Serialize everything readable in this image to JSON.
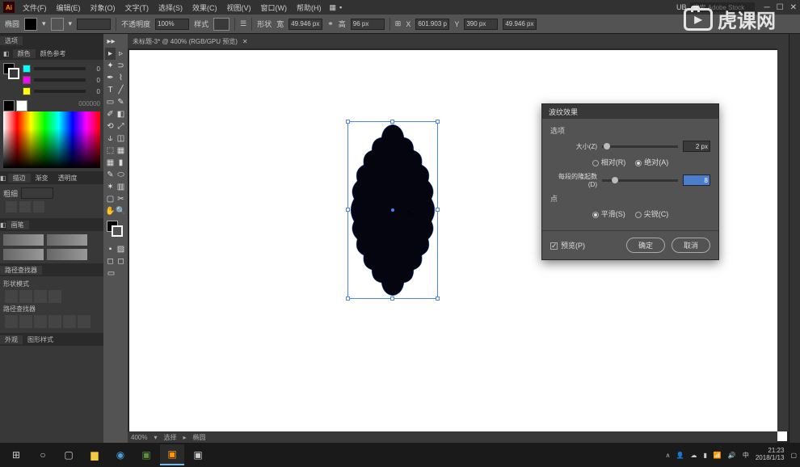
{
  "app_icon": "Ai",
  "menubar": {
    "items": [
      "文件(F)",
      "编辑(E)",
      "对象(O)",
      "文字(T)",
      "选择(S)",
      "效果(C)",
      "视图(V)",
      "窗口(W)",
      "帮助(H)"
    ],
    "search_placeholder": "搜索 Adobe Stock",
    "layout_label": "UB"
  },
  "options": {
    "label_left": "椭圆",
    "opacity_label": "不透明度",
    "opacity_value": "100%",
    "style_label": "样式",
    "xform_label": "形状",
    "w_label": "宽",
    "w_value": "49.946 px",
    "h_label": "高",
    "h_value": "96 px",
    "x_label": "X",
    "x_value": "601.903 px",
    "y_label": "Y",
    "y_value": "390 px",
    "field5": "49.946 px"
  },
  "left_panels": {
    "tabs_row1": [
      "选项",
      ""
    ],
    "color_title": "颜色",
    "color_guide": "颜色参考",
    "sliders": [
      {
        "v": "0"
      },
      {
        "v": "0"
      },
      {
        "v": "0"
      }
    ],
    "hex": "000000",
    "stroke_title": "描边",
    "grad_title": "渐变",
    "trans_title": "透明度",
    "weight_label": "粗细",
    "brush_title": "画笔",
    "path_title": "路径查找器",
    "shape_mode": "形状模式",
    "pathfinder": "路径查找器",
    "appear_title": "外观",
    "graphic_styles": "图形样式"
  },
  "document": {
    "tab_title": "未标题-3* @ 400% (RGB/GPU 预览)",
    "zoom": "400%",
    "status_sel": "选择",
    "status_tool": "椭圆"
  },
  "dialog": {
    "title": "波纹效果",
    "section": "选项",
    "size_label": "大小(Z)",
    "size_value": "2 px",
    "relative": "相对(R)",
    "absolute": "绝对(A)",
    "ridges_label": "每段的隆起数(D)",
    "ridges_value": "8",
    "points_label": "点",
    "smooth": "平滑(S)",
    "corner": "尖锐(C)",
    "preview": "预览(P)",
    "ok": "确定",
    "cancel": "取消"
  },
  "watermark": "虎课网",
  "taskbar": {
    "time": "21:23",
    "date": "2018/1/13"
  }
}
